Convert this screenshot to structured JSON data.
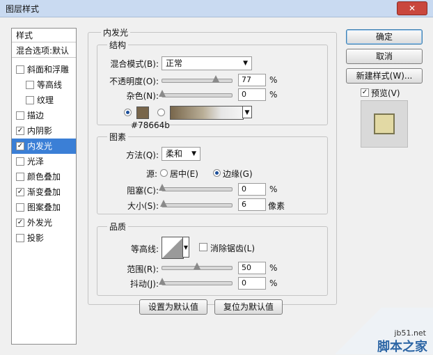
{
  "window": {
    "title": "图层样式",
    "close_glyph": "✕"
  },
  "left_panel": {
    "header": "样式",
    "blend_options": "混合选项:默认",
    "items": [
      {
        "label": "斜面和浮雕",
        "checked": false
      },
      {
        "label": "等高线",
        "checked": false
      },
      {
        "label": "纹理",
        "checked": false
      },
      {
        "label": "描边",
        "checked": false
      },
      {
        "label": "内阴影",
        "checked": true
      },
      {
        "label": "内发光",
        "checked": true
      },
      {
        "label": "光泽",
        "checked": false
      },
      {
        "label": "颜色叠加",
        "checked": false
      },
      {
        "label": "渐变叠加",
        "checked": true
      },
      {
        "label": "图案叠加",
        "checked": false
      },
      {
        "label": "外发光",
        "checked": true
      },
      {
        "label": "投影",
        "checked": false
      }
    ]
  },
  "panel": {
    "title": "内发光",
    "structure": {
      "label": "结构",
      "blend_mode_label": "混合模式(B):",
      "blend_mode_value": "正常",
      "opacity_label": "不透明度(O):",
      "opacity_value": "77",
      "noise_label": "杂色(N):",
      "noise_value": "0",
      "unit_percent": "%",
      "color_hex": "#78664b"
    },
    "elements": {
      "label": "图素",
      "method_label": "方法(Q):",
      "method_value": "柔和",
      "source_label": "源:",
      "source_center": "居中(E)",
      "source_edge": "边缘(G)",
      "choke_label": "阻塞(C):",
      "choke_value": "0",
      "size_label": "大小(S):",
      "size_value": "6",
      "size_unit": "像素"
    },
    "quality": {
      "label": "品质",
      "contour_label": "等高线:",
      "antialias_label": "消除锯齿(L)",
      "range_label": "范围(R):",
      "range_value": "50",
      "jitter_label": "抖动(J):",
      "jitter_value": "0"
    },
    "default_button": "设置为默认值",
    "reset_button": "复位为默认值"
  },
  "right": {
    "ok": "确定",
    "cancel": "取消",
    "new_style": "新建样式(W)...",
    "preview_label": "预览(V)"
  },
  "watermark": {
    "site": "jb51.net",
    "name": "脚本之家"
  },
  "colors": {
    "selection": "#3b7fd6",
    "glow": "#78664b",
    "preview_swatch": "#e2d9a4",
    "title_bar": "#c9daf1"
  }
}
